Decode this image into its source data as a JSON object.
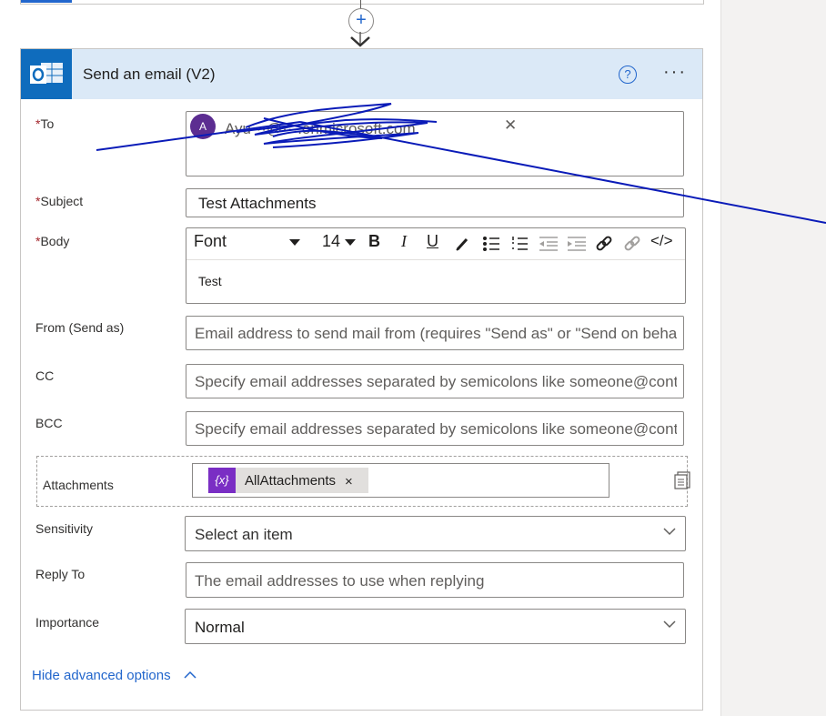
{
  "canvas": {
    "accent": "#0f6cbd",
    "header_bg": "#dbe9f7",
    "link_color": "#2266cc"
  },
  "connector": {
    "add_symbol": "+",
    "icon": "plus-circle-icon"
  },
  "card": {
    "title": "Send an email (V2)",
    "help_symbol": "?",
    "more_symbol": "···",
    "action_icon": "outlook-icon"
  },
  "fields": {
    "to": {
      "label": "To",
      "required": "*",
      "avatar_initial": "A",
      "recipient_visible": "Ayu···@···.onmicrosoft.com",
      "remove": "✕"
    },
    "subject": {
      "label": "Subject",
      "required": "*",
      "value": "Test Attachments"
    },
    "body": {
      "label": "Body",
      "required": "*",
      "toolbar": {
        "font": "Font",
        "size": "14",
        "bold": "B",
        "italic": "I",
        "underline": "U",
        "code": "</>"
      },
      "value": "Test"
    },
    "from": {
      "label": "From (Send as)",
      "placeholder": "Email address to send mail from (requires \"Send as\" or \"Send on behalf of\" permission)"
    },
    "cc": {
      "label": "CC",
      "placeholder": "Specify email addresses separated by semicolons like someone@contoso.com"
    },
    "bcc": {
      "label": "BCC",
      "placeholder": "Specify email addresses separated by semicolons like someone@contoso.com"
    },
    "attachments": {
      "label": "Attachments",
      "token_icon": "{x}",
      "token": "AllAttachments",
      "token_remove": "×"
    },
    "sensitivity": {
      "label": "Sensitivity",
      "placeholder": "Select an item"
    },
    "reply_to": {
      "label": "Reply To",
      "placeholder": "The email addresses to use when replying"
    },
    "importance": {
      "label": "Importance",
      "value": "Normal"
    }
  },
  "footer": {
    "hide_advanced": "Hide advanced options"
  }
}
